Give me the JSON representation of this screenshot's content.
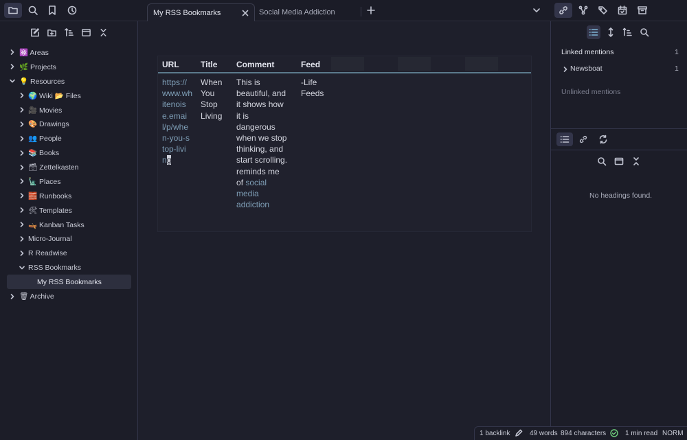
{
  "tabs": [
    {
      "label": "My RSS Bookmarks",
      "active": true
    },
    {
      "label": "Social Media Addiction",
      "active": false
    }
  ],
  "ribbon_icons": [
    "folder-icon",
    "search-icon",
    "bookmark-icon",
    "clock-icon"
  ],
  "right_top_icons": [
    "backlinks-icon",
    "graph-icon",
    "tags-icon",
    "calendar-icon",
    "archive-icon"
  ],
  "file_tree": [
    {
      "label": "⚛️ Areas",
      "expanded": false
    },
    {
      "label": "🌿 Projects",
      "expanded": false
    },
    {
      "label": "💡 Resources",
      "expanded": true
    },
    {
      "label": "🌍 Wiki 📂 Files",
      "expanded": false
    },
    {
      "label": "🎥 Movies",
      "expanded": false
    },
    {
      "label": "🎨 Drawings",
      "expanded": false
    },
    {
      "label": "👥 People",
      "expanded": false
    },
    {
      "label": "📚 Books",
      "expanded": false
    },
    {
      "label": "🗃 Zettelkasten",
      "expanded": false
    },
    {
      "label": "🗽 Places",
      "expanded": false
    },
    {
      "label": "🧱 Runbooks",
      "expanded": false
    },
    {
      "label": "🛠 Templates",
      "expanded": false
    },
    {
      "label": "🛶 Kanban Tasks",
      "expanded": false
    },
    {
      "label": "Micro-Journal",
      "expanded": false
    },
    {
      "label": "R Readwise",
      "expanded": false
    },
    {
      "label": "RSS Bookmarks",
      "expanded": true
    },
    {
      "label": "My RSS Bookmarks",
      "selected": true
    },
    {
      "label": "🗑 Archive",
      "expanded": false
    }
  ],
  "table": {
    "headers": [
      "URL",
      "Title",
      "Comment",
      "Feed"
    ],
    "url_lines": [
      "https://",
      "www.wh",
      "itenois",
      "e.emai",
      "l/p/whe",
      "n-you-s",
      "top-livi",
      "n"
    ],
    "url_cursor_char": "g",
    "title_lines": [
      "When",
      "You",
      "Stop",
      "Living"
    ],
    "comment_lines": [
      "This is",
      "beautiful, and",
      "it shows how",
      "it is",
      "dangerous",
      "when we stop",
      "thinking, and",
      "start scrolling.",
      "reminds me"
    ],
    "comment_prefix": "of",
    "comment_link_lines": [
      "social",
      "media",
      "addiction"
    ],
    "feed_lines": [
      "-Life",
      "Feeds"
    ]
  },
  "backlinks": {
    "linked_label": "Linked mentions",
    "linked_count": "1",
    "items": [
      {
        "label": "Newsboat",
        "count": "1"
      }
    ],
    "unlinked_label": "Unlinked mentions"
  },
  "outline": {
    "empty_text": "No headings found."
  },
  "status_bar": {
    "backlinks": "1 backlink",
    "words": "49 words",
    "characters": "894 characters",
    "read_time": "1 min read",
    "mode": "NORM"
  },
  "colors": {
    "accent": "#7f9fb7",
    "background": "#1e1f2b",
    "sidebar": "#1c1d28"
  }
}
